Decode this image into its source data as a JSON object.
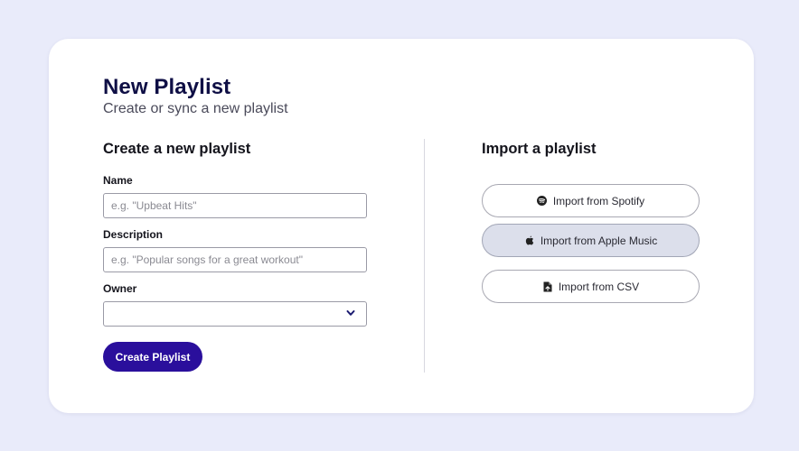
{
  "header": {
    "title": "New Playlist",
    "subtitle": "Create or sync a new playlist"
  },
  "create_section": {
    "title": "Create a new playlist",
    "fields": {
      "name": {
        "label": "Name",
        "value": "",
        "placeholder": "e.g. \"Upbeat Hits\""
      },
      "description": {
        "label": "Description",
        "value": "",
        "placeholder": "e.g. \"Popular songs for a great workout\""
      },
      "owner": {
        "label": "Owner",
        "selected": ""
      }
    },
    "submit_label": "Create Playlist"
  },
  "import_section": {
    "title": "Import a playlist",
    "options": [
      {
        "label": "Import from Spotify",
        "icon": "spotify-icon"
      },
      {
        "label": "Import from Apple Music",
        "icon": "apple-icon"
      },
      {
        "label": "Import from CSV",
        "icon": "csv-file-icon"
      }
    ]
  },
  "colors": {
    "background": "#e9ebfa",
    "card": "#ffffff",
    "primary_button": "#2a0f9c",
    "title_text": "#0f0f45",
    "hover_button": "#dcdfeb"
  }
}
